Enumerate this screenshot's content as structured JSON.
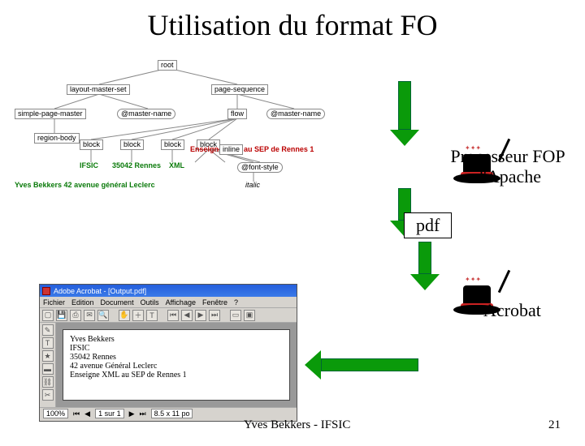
{
  "title": "Utilisation du format FO",
  "labels": {
    "processor": "Processeur FOP\nd'Apache",
    "pdf": "pdf",
    "acrobat": "Acrobat"
  },
  "tree": {
    "root": "root",
    "layout_master_set": "layout-master-set",
    "simple_page_master": "simple-page-master",
    "master_name1": "@master-name",
    "region_body": "region-body",
    "page_sequence": "page-sequence",
    "master_name2": "@master-name",
    "flow": "flow",
    "blocks": [
      "block",
      "block",
      "block",
      "block"
    ],
    "ifisic": "IFSIC",
    "addr": "35042 Rennes",
    "xml": "XML",
    "font_style": "@font-style",
    "font_style_val": "italic",
    "teach": "Enseigne",
    "inline": "inline",
    "sep": "au SEP de Rennes 1",
    "author_line": "Yves Bekkers   42 avenue général Leclerc"
  },
  "acrobat_window": {
    "title": "Adobe Acrobat - [Output.pdf]",
    "menu": [
      "Fichier",
      "Edition",
      "Document",
      "Outils",
      "Affichage",
      "Fenêtre",
      "?"
    ],
    "doc_lines": [
      "Yves Bekkers",
      "IFSIC",
      "35042 Rennes",
      "42 avenue Général Leclerc",
      "Enseigne XML au SEP de Rennes 1"
    ],
    "status_zoom": "100%",
    "status_page": "1 sur 1",
    "status_size": "8.5 x 11 po"
  },
  "footer": {
    "author": "Yves Bekkers - IFSIC",
    "page": "21"
  }
}
